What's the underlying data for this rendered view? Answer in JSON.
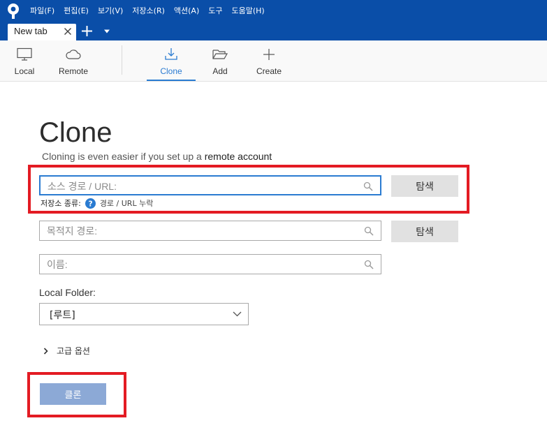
{
  "menu": [
    {
      "label": "파일(F)"
    },
    {
      "label": "편집(E)"
    },
    {
      "label": "보기(V)"
    },
    {
      "label": "저장소(R)"
    },
    {
      "label": "액션(A)"
    },
    {
      "label": "도구"
    },
    {
      "label": "도움말(H)"
    }
  ],
  "tabs": [
    {
      "label": "New tab"
    }
  ],
  "toolbar": {
    "local": "Local",
    "remote": "Remote",
    "clone": "Clone",
    "add": "Add",
    "create": "Create",
    "active": "Clone"
  },
  "main": {
    "title": "Clone",
    "subtitle_prefix": "Cloning is even easier if you set up a ",
    "subtitle_link": "remote account",
    "source": {
      "placeholder": "소스 경로 / URL:",
      "value": ""
    },
    "browse_label": "탐색",
    "repo_type_label": "저장소 종류:",
    "repo_type_value": "경로 / URL 누락",
    "destination": {
      "placeholder": "목적지 경로:",
      "value": ""
    },
    "name": {
      "placeholder": "이름:",
      "value": ""
    },
    "local_folder_label": "Local Folder:",
    "local_folder_value": "[루트]",
    "advanced_label": "고급 옵션",
    "clone_button": "클론"
  },
  "colors": {
    "topbar": "#0a4ea8",
    "accent": "#2a7bd1",
    "highlight": "#e31b23",
    "clone_button": "#8ca9d6"
  },
  "icons": [
    "sourcetree-logo-icon",
    "close-icon",
    "plus-icon",
    "chevron-down-icon",
    "monitor-icon",
    "cloud-icon",
    "download-icon",
    "folder-open-icon",
    "plus-icon",
    "search-icon",
    "help-icon",
    "chevron-right-icon"
  ]
}
